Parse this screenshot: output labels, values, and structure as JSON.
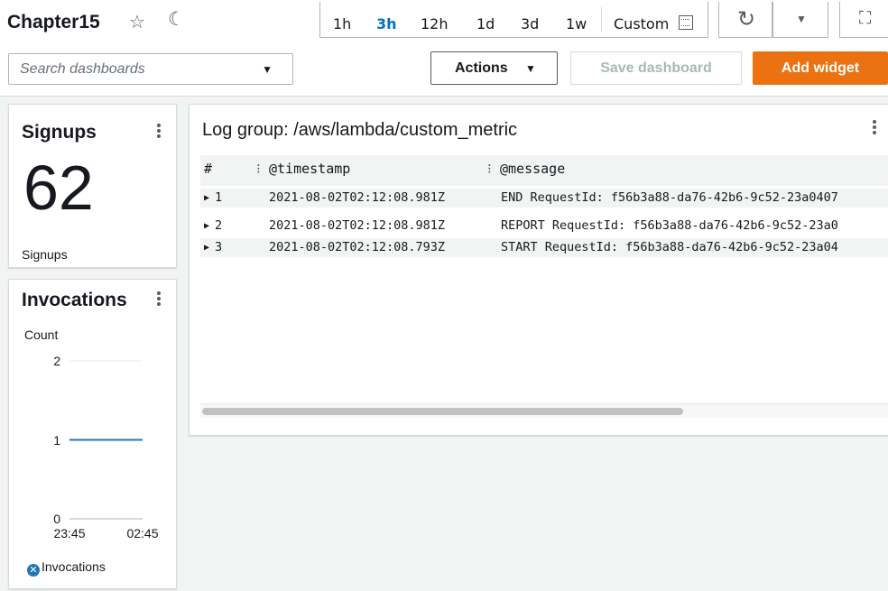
{
  "header": {
    "title": "Chapter15",
    "time_ranges": [
      "1h",
      "3h",
      "12h",
      "1d",
      "3d",
      "1w"
    ],
    "active_range": "3h",
    "custom_label": "Custom"
  },
  "toolbar": {
    "search_placeholder": "Search dashboards",
    "actions_label": "Actions",
    "save_label": "Save dashboard",
    "add_widget_label": "Add widget"
  },
  "colors": {
    "accent": "#ec7211",
    "active_range": "#0073bb",
    "series": "#1f77b4"
  },
  "signups_widget": {
    "title": "Signups",
    "value": "62",
    "label": "Signups"
  },
  "invocations_widget": {
    "title": "Invocations",
    "unit_label": "Count",
    "legend": "Invocations"
  },
  "chart_data": {
    "type": "line",
    "title": "Invocations",
    "ylabel": "Count",
    "ylim": [
      0,
      2
    ],
    "yticks": [
      "2",
      "1",
      "0"
    ],
    "xticks": [
      "23:45",
      "02:45"
    ],
    "series": [
      {
        "name": "Invocations",
        "points": [
          [
            "23:45",
            1
          ],
          [
            "02:45",
            1
          ]
        ]
      }
    ],
    "legend": "bottom-left"
  },
  "log_widget": {
    "title": "Log group: /aws/lambda/custom_metric",
    "columns": [
      "#",
      "@timestamp",
      "@message"
    ],
    "rows": [
      {
        "n": "1",
        "timestamp": "2021-08-02T02:12:08.981Z",
        "message": "END RequestId: f56b3a88-da76-42b6-9c52-23a0407"
      },
      {
        "n": "2",
        "timestamp": "2021-08-02T02:12:08.981Z",
        "message": "REPORT RequestId: f56b3a88-da76-42b6-9c52-23a0"
      },
      {
        "n": "3",
        "timestamp": "2021-08-02T02:12:08.793Z",
        "message": "START RequestId: f56b3a88-da76-42b6-9c52-23a04"
      }
    ]
  }
}
